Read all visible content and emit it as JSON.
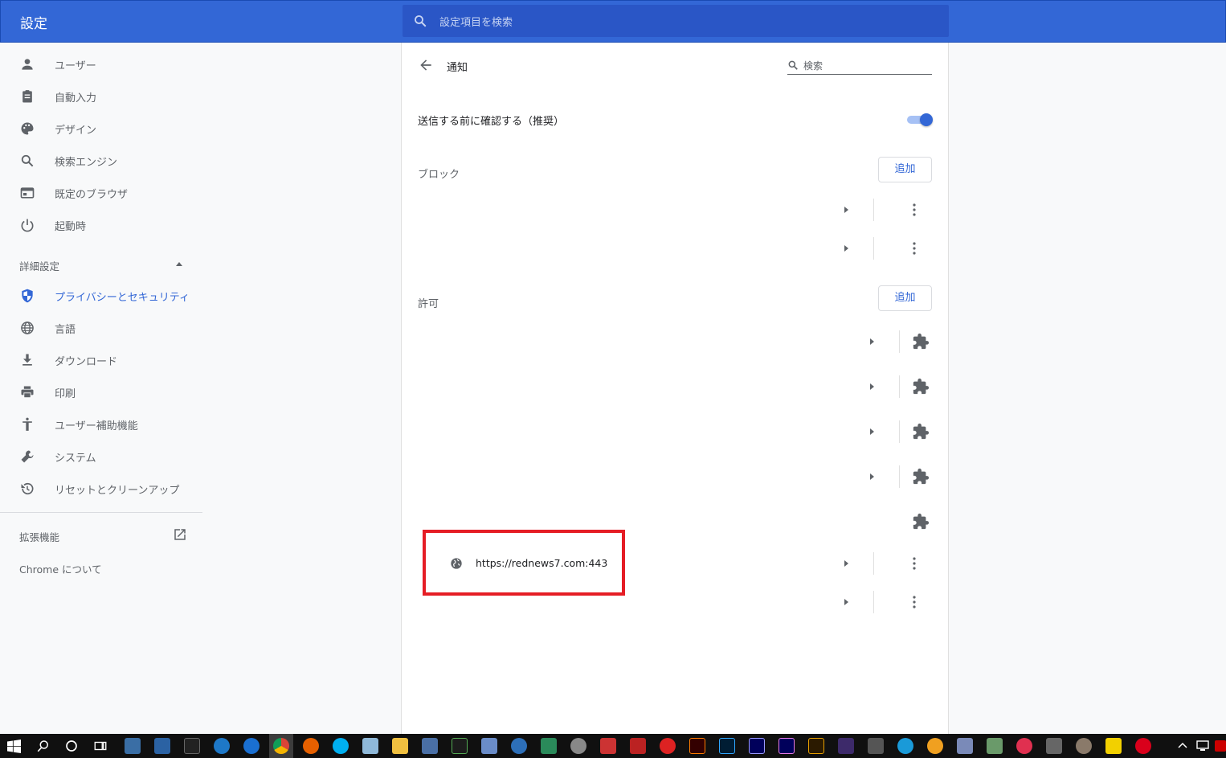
{
  "header": {
    "title": "設定",
    "search_placeholder": "設定項目を検索"
  },
  "sidebar": {
    "items": [
      {
        "label": "ユーザー",
        "icon": "person-icon"
      },
      {
        "label": "自動入力",
        "icon": "clipboard-icon"
      },
      {
        "label": "デザイン",
        "icon": "palette-icon"
      },
      {
        "label": "検索エンジン",
        "icon": "search-icon"
      },
      {
        "label": "既定のブラウザ",
        "icon": "browser-window-icon"
      },
      {
        "label": "起動時",
        "icon": "power-icon"
      }
    ],
    "advanced_label": "詳細設定",
    "advanced_items": [
      {
        "label": "プライバシーとセキュリティ",
        "icon": "shield-icon"
      },
      {
        "label": "言語",
        "icon": "globe-icon"
      },
      {
        "label": "ダウンロード",
        "icon": "download-icon"
      },
      {
        "label": "印刷",
        "icon": "printer-icon"
      },
      {
        "label": "ユーザー補助機能",
        "icon": "accessibility-icon"
      },
      {
        "label": "システム",
        "icon": "wrench-icon"
      },
      {
        "label": "リセットとクリーンアップ",
        "icon": "history-icon"
      }
    ],
    "extensions_label": "拡張機能",
    "about_label": "Chrome について"
  },
  "main": {
    "title": "通知",
    "search_placeholder": "検索",
    "ask_label": "送信する前に確認する（推奨）",
    "block_label": "ブロック",
    "allow_label": "許可",
    "add_label": "追加",
    "allow_site_url": "https://rednews7.com:443"
  },
  "colors": {
    "header": "#3367d6",
    "accent": "#3367d6",
    "highlight": "#e51d25"
  }
}
